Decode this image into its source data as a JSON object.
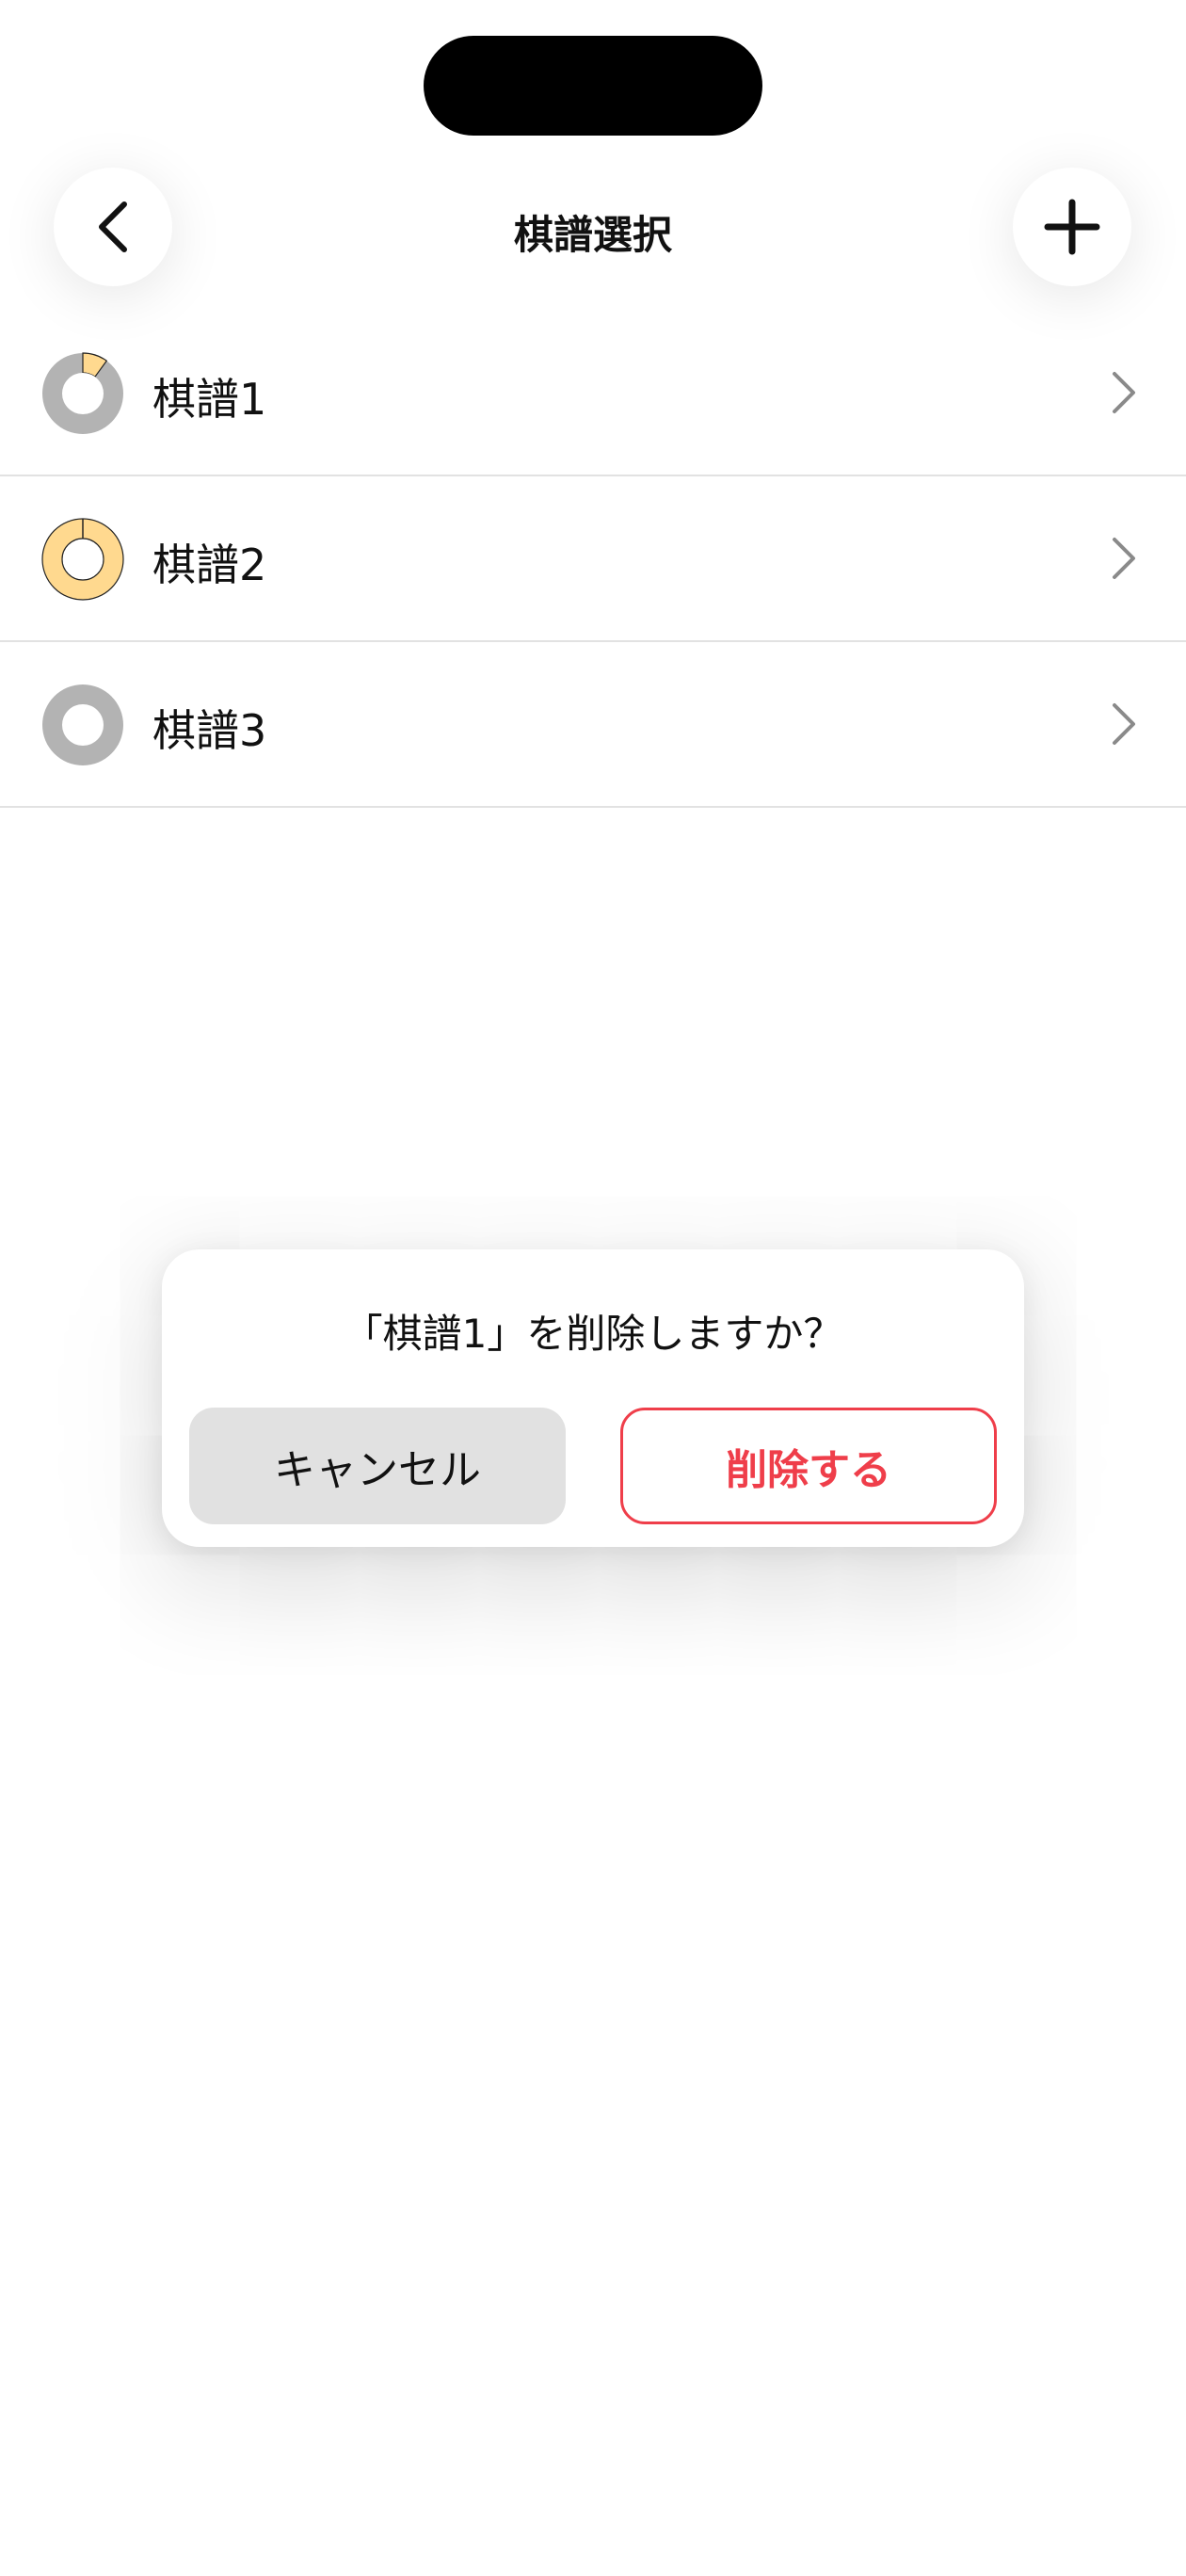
{
  "header": {
    "title": "棋譜選択",
    "back_icon": "chevron-left-icon",
    "add_icon": "plus-icon"
  },
  "list": {
    "items": [
      {
        "label": "棋譜1",
        "progress": 0.1
      },
      {
        "label": "棋譜2",
        "progress": 1.0
      },
      {
        "label": "棋譜3",
        "progress": 0.0
      }
    ]
  },
  "dialog": {
    "message": "「棋譜1」を削除しますか？",
    "cancel_label": "キャンセル",
    "delete_label": "削除する"
  },
  "colors": {
    "progress_fill": "#ffd98f",
    "progress_track": "#b3b3b3",
    "danger": "#ef3e4a",
    "cancel_bg": "#e1e1e1"
  }
}
